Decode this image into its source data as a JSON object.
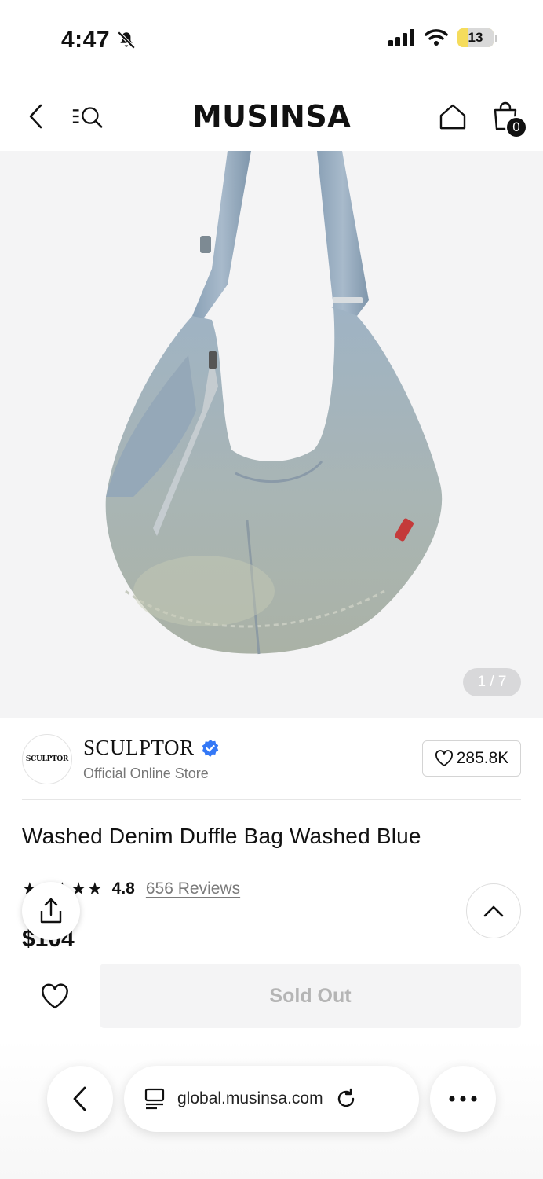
{
  "status_bar": {
    "time": "4:47",
    "battery": "13"
  },
  "header": {
    "logo": "MUSINSA",
    "cart_count": "0"
  },
  "gallery": {
    "counter": "1 / 7"
  },
  "brand": {
    "logo_text": "SCULPTOR",
    "name": "SCULPTOR",
    "subtitle": "Official Online Store",
    "likes": "285.8K"
  },
  "product": {
    "title": "Washed Denim Duffle Bag Washed Blue",
    "rating": "4.8",
    "reviews": "656 Reviews",
    "price": "$104"
  },
  "buy_bar": {
    "sold_out_label": "Sold Out"
  },
  "browser": {
    "url": "global.musinsa.com"
  },
  "colors": {
    "accent": "#3478f6",
    "battery": "#f5dc5c",
    "sold_out_bg": "#f4f4f5"
  }
}
